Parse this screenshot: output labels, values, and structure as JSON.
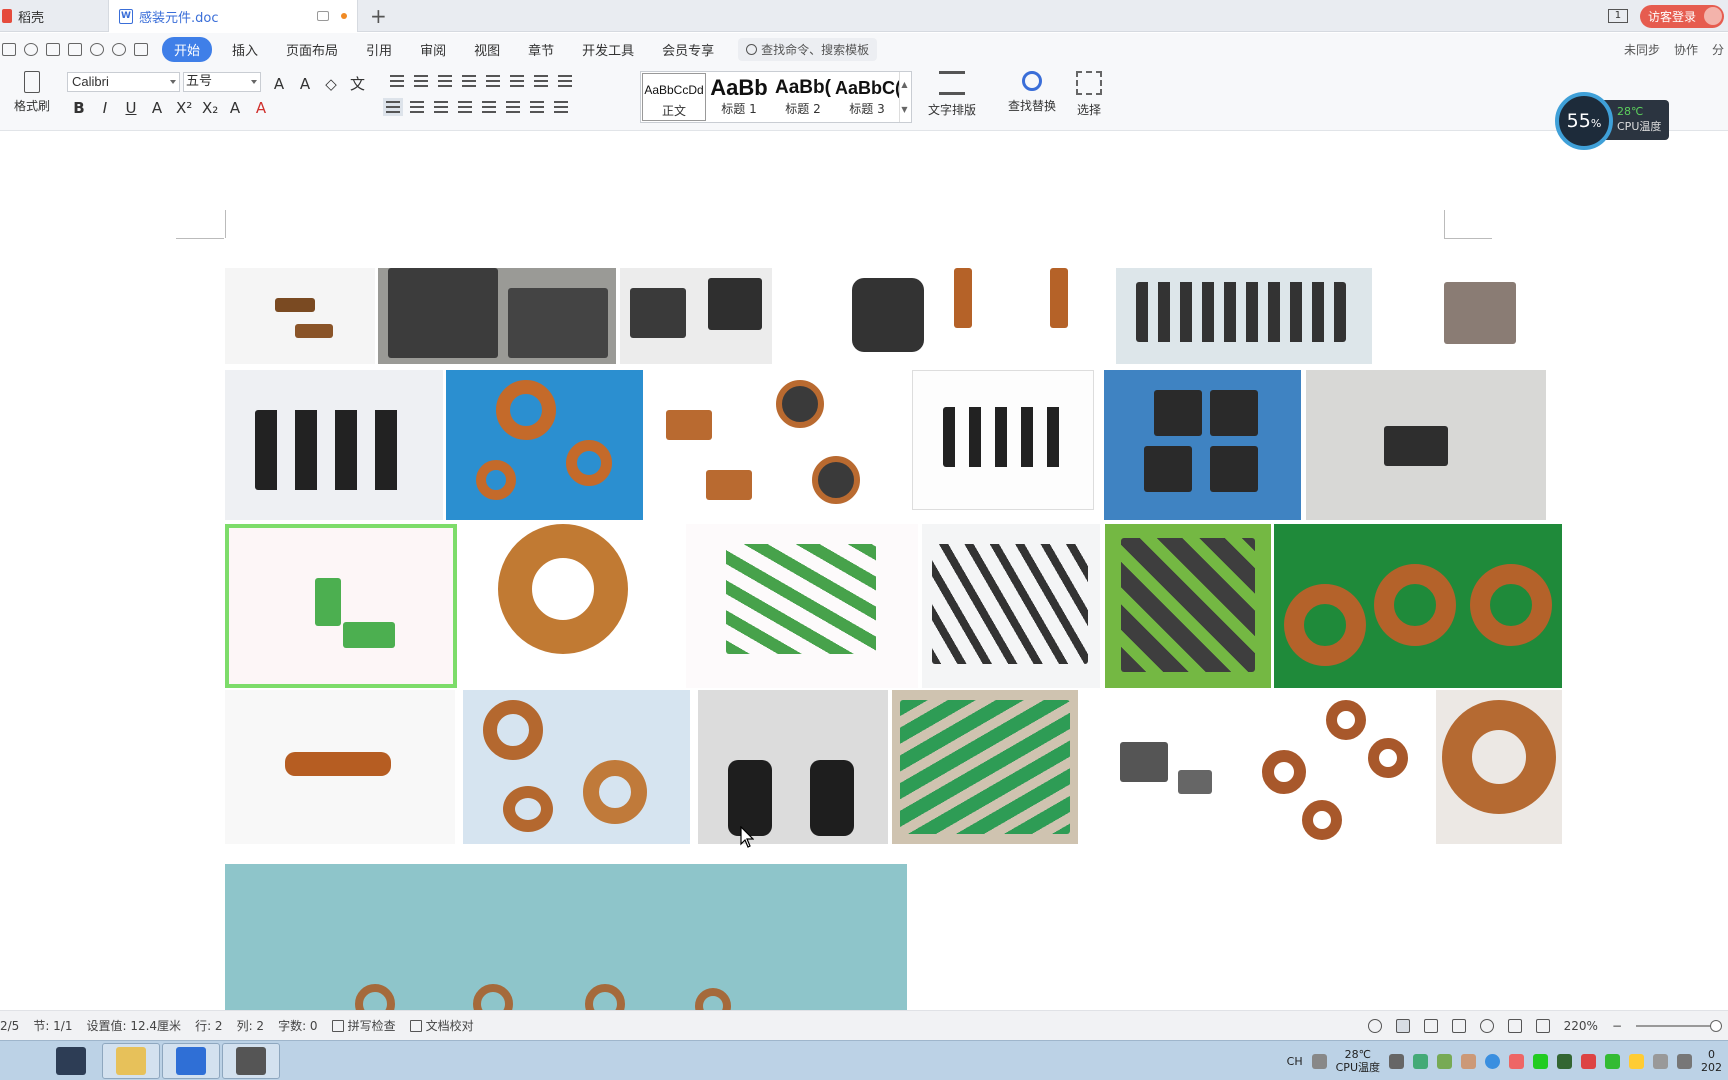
{
  "titlebar": {
    "home_tab": "稻壳",
    "doc_tab": "感装元件.doc",
    "doc_icon": "W",
    "new_tab_icon": "+",
    "window_count": "1",
    "login": "访客登录"
  },
  "menubar": {
    "items": [
      "开始",
      "插入",
      "页面布局",
      "引用",
      "审阅",
      "视图",
      "章节",
      "开发工具",
      "会员专享"
    ],
    "search_placeholder": "查找命令、搜索模板",
    "sync": "未同步",
    "collab": "协作",
    "share": "分"
  },
  "ribbon": {
    "format_painter": "格式刷",
    "font_name": "Calibri",
    "font_size": "五号",
    "format_glyphs": [
      "B",
      "I",
      "U",
      "A",
      "X²",
      "X₂",
      "A",
      "A"
    ],
    "styles": [
      {
        "sample": "AaBbCcDd",
        "label": "正文"
      },
      {
        "sample": "AaBb",
        "label": "标题 1"
      },
      {
        "sample": "AaBb(",
        "label": "标题 2"
      },
      {
        "sample": "AaBbC(",
        "label": "标题 3"
      }
    ],
    "text_layout": "文字排版",
    "find_replace": "查找替换",
    "select": "选择"
  },
  "cpu_widget": {
    "percent": "55",
    "percent_sign": "%",
    "temp": "28℃",
    "label": "CPU温度"
  },
  "statusbar": {
    "page": "2/5",
    "section": "节: 1/1",
    "setting": "设置值: 12.4厘米",
    "row": "行: 2",
    "col": "列: 2",
    "words": "字数: 0",
    "spell": "拼写检查",
    "proof": "文档校对",
    "zoom": "220%"
  },
  "taskbar": {
    "tray_lang": "CH",
    "tray_temp": "28℃",
    "tray_cpu": "CPU温度",
    "clock_line1": "0",
    "clock_line2": "202"
  },
  "colors": {
    "accent": "#3f7fe8",
    "login_red": "#e65c4f",
    "taskbar": "#bcd2e6"
  }
}
